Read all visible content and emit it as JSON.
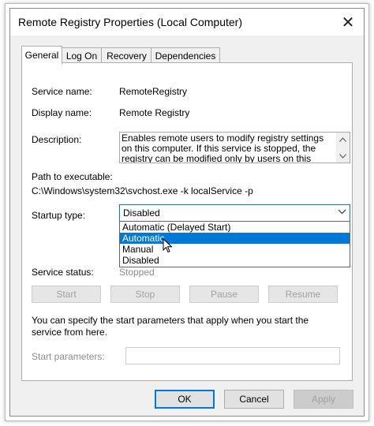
{
  "window": {
    "title": "Remote Registry Properties (Local Computer)",
    "close_glyph": "✕"
  },
  "tabs": [
    {
      "label": "General",
      "active": true
    },
    {
      "label": "Log On",
      "active": false
    },
    {
      "label": "Recovery",
      "active": false
    },
    {
      "label": "Dependencies",
      "active": false
    }
  ],
  "general": {
    "service_name_label": "Service name:",
    "service_name_value": "RemoteRegistry",
    "display_name_label": "Display name:",
    "display_name_value": "Remote Registry",
    "description_label": "Description:",
    "description_value": "Enables remote users to modify registry settings on this computer. If this service is stopped, the registry can be modified only by users on this computer. If",
    "path_label": "Path to executable:",
    "path_value": "C:\\Windows\\system32\\svchost.exe -k localService -p",
    "startup_type_label": "Startup type:",
    "startup_type_value": "Disabled",
    "startup_options": [
      "Automatic (Delayed Start)",
      "Automatic",
      "Manual",
      "Disabled"
    ],
    "startup_highlighted": "Automatic",
    "service_status_label": "Service status:",
    "service_status_value": "Stopped",
    "start_label": "Start",
    "stop_label": "Stop",
    "pause_label": "Pause",
    "resume_label": "Resume",
    "start_params_note": "You can specify the start parameters that apply when you start the service from here.",
    "start_params_label": "Start parameters:",
    "start_params_value": ""
  },
  "dialog_buttons": {
    "ok": "OK",
    "cancel": "Cancel",
    "apply": "Apply"
  },
  "icons": {
    "scroll_up": "scroll-up-icon",
    "scroll_down": "scroll-down-icon",
    "combo_arrow": "chevron-down-icon",
    "cursor": "mouse-pointer-icon"
  },
  "colors": {
    "accent": "#0078d7",
    "window_bg": "#f0f0f0",
    "disabled_text": "#a0a0a0"
  }
}
